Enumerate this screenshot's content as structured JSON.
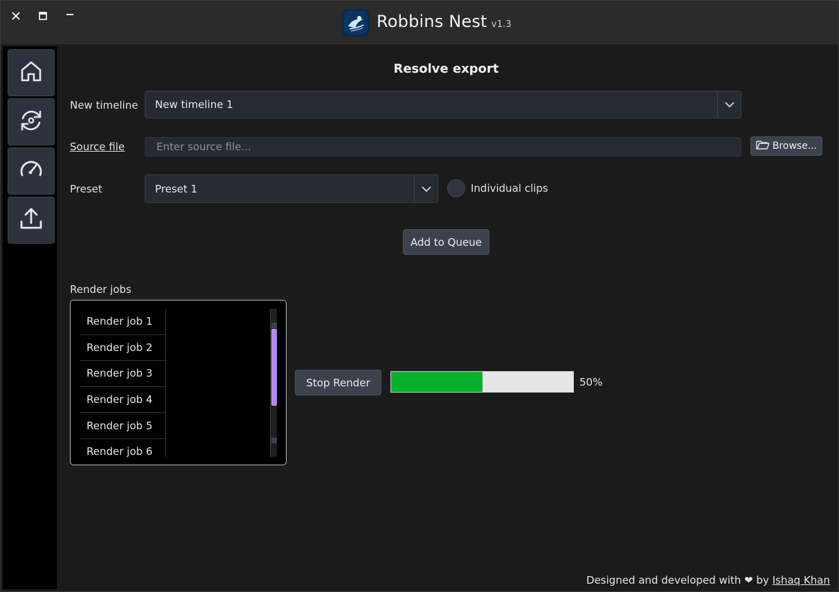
{
  "window": {
    "title": "Robbins Nest",
    "version": "v1.3",
    "controls": {
      "close_icon": "close-icon",
      "maximize_icon": "maximize-icon",
      "minimize_icon": "minimize-icon"
    }
  },
  "sidebar": {
    "items": [
      {
        "name": "home",
        "icon": "home-icon"
      },
      {
        "name": "convert",
        "icon": "refresh-icon"
      },
      {
        "name": "speed",
        "icon": "gauge-icon"
      },
      {
        "name": "export",
        "icon": "upload-icon"
      }
    ]
  },
  "main": {
    "title": "Resolve export",
    "new_timeline": {
      "label": "New timeline",
      "value": "New timeline 1"
    },
    "source_file": {
      "label": "Source file",
      "placeholder": "Enter source file...",
      "value": ""
    },
    "browse_label": "Browse...",
    "preset": {
      "label": "Preset",
      "value": "Preset 1"
    },
    "individual_clips": {
      "label": "Individual clips",
      "checked": false
    },
    "add_queue_label": "Add to Queue",
    "render_jobs": {
      "label": "Render jobs",
      "items": [
        "Render job 1",
        "Render job 2",
        "Render job 3",
        "Render job 4",
        "Render job 5",
        "Render job 6"
      ]
    },
    "stop_render_label": "Stop Render",
    "progress": {
      "value": 0.5,
      "text": "50%"
    }
  },
  "footer": {
    "text": "Designed and developed with",
    "heart": "❤",
    "by": "by",
    "author": "Ishaq Khan"
  },
  "colors": {
    "accent_progress": "#06b02a",
    "scroll_thumb": "#b48cf2",
    "button_bg": "#3b424e"
  }
}
